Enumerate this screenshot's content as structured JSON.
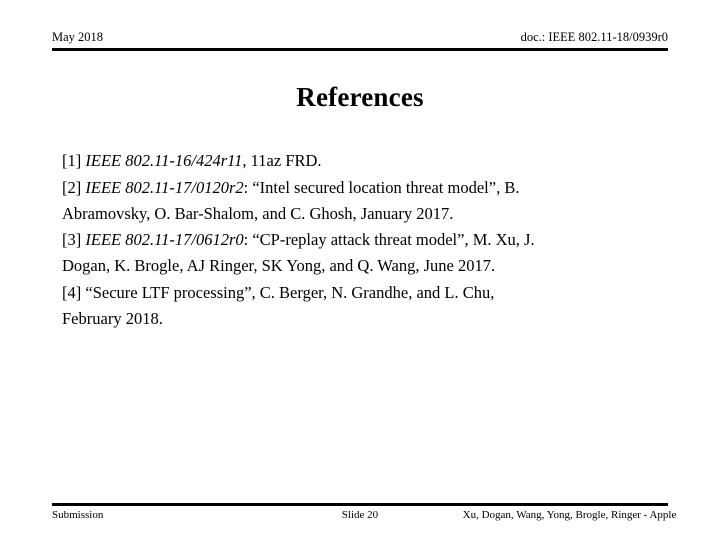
{
  "header": {
    "left": "May 2018",
    "right": "doc.: IEEE 802.11-18/0939r0"
  },
  "title": "References",
  "references": [
    {
      "marker": "[1]",
      "doc_number": "IEEE 802.11-16/424r11",
      "lines": [
        "[1] IEEE 802.11-16/424r11, 11az FRD."
      ],
      "line1_prefix": "[1] ",
      "line1_italic": "IEEE 802.11-16/424r11",
      "line1_suffix": ", 11az FRD.",
      "line2": ""
    },
    {
      "marker": "[2]",
      "doc_number": "IEEE 802.11-17/0120r2",
      "lines": [
        "[2] IEEE 802.11-17/0120r2: “Intel secured location threat model”,  B.",
        "Abramovsky, O. Bar-Shalom, and C. Ghosh,  January 2017."
      ],
      "line1_prefix": "[2] ",
      "line1_italic": "IEEE 802.11-17/0120r2",
      "line1_suffix": ": “Intel secured location threat model”,  B.",
      "line2": "Abramovsky, O. Bar-Shalom, and C. Ghosh,  January 2017."
    },
    {
      "marker": "[3]",
      "doc_number": "IEEE 802.11-17/0612r0",
      "lines": [
        "[3] IEEE 802.11-17/0612r0: “CP-replay attack threat model”,  M. Xu, J.",
        "Dogan, K. Brogle, AJ Ringer, SK Yong, and Q. Wang,  June 2017."
      ],
      "line1_prefix": "[3] ",
      "line1_italic": "IEEE 802.11-17/0612r0",
      "line1_suffix": ": “CP-replay attack threat model”,  M. Xu, J.",
      "line2": "Dogan, K. Brogle, AJ Ringer, SK Yong, and Q. Wang,  June 2017."
    },
    {
      "marker": "[4]",
      "doc_number": "",
      "lines": [
        "[4] “Secure LTF processing”, C. Berger,  N. Grandhe, and L. Chu,",
        "February 2018."
      ],
      "line1_prefix": "[4] “Secure LTF processing”, C. Berger,  N. Grandhe, and L. Chu,",
      "line1_italic": "",
      "line1_suffix": "",
      "line2": "February 2018."
    }
  ],
  "footer": {
    "left": "Submission",
    "center": "Slide 20",
    "right": "Xu, Dogan, Wang, Yong, Brogle, Ringer - Apple"
  },
  "colors": {
    "text": "#000000",
    "background": "#ffffff",
    "rule": "#000000"
  }
}
